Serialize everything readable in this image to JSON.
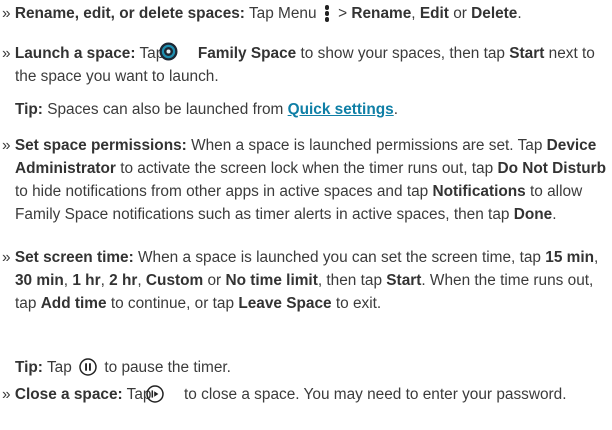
{
  "bullet": "»",
  "items": {
    "rename": {
      "title": "Rename, edit, or delete spaces:",
      "t1": "Tap Menu",
      "t2": ">",
      "b1": "Rename",
      "t3": ",",
      "b2": "Edit",
      "t4": "or",
      "b3": "Delete",
      "t5": "."
    },
    "launch": {
      "title": "Launch a space:",
      "t1": "Tap",
      "b1": "Family Space",
      "t2": "to show your spaces, then tap",
      "b2": "Start",
      "t3": "next to the space you want to launch."
    },
    "tip1": {
      "label": "Tip:",
      "t1": "Spaces can also be launched from",
      "link": "Quick settings",
      "t2": "."
    },
    "permissions": {
      "title": "Set space permissions:",
      "t1": "When a space is launched permissions are set. Tap",
      "b1": "Device Administrator",
      "t2": "to activate the screen lock when the timer runs out, tap",
      "b2": "Do Not Disturb",
      "t3": "to hide notifications from other apps in active spaces and tap",
      "b3": "Notifications",
      "t4": "to allow Family Space notifications such as timer alerts in active spaces, then tap",
      "b4": "Done",
      "t5": "."
    },
    "screentime": {
      "title": "Set screen time:",
      "t1": "When a space is launched you can set the screen time, tap",
      "b1": "15 min",
      "c1": ",",
      "b2": "30 min",
      "c2": ",",
      "b3": "1 hr",
      "c3": ",",
      "b4": "2 hr",
      "c4": ",",
      "b5": "Custom",
      "t2": "or",
      "b6": "No time limit",
      "t3": ", then tap",
      "b7": "Start",
      "t4": ". When the time runs out, tap",
      "b8": "Add time",
      "t5": "to continue, or tap",
      "b9": "Leave Space",
      "t6": "to exit."
    },
    "tip2": {
      "label": "Tip:",
      "t1": "Tap",
      "t2": "to pause the timer."
    },
    "close": {
      "title": "Close a space:",
      "t1": "Tap",
      "t2": "to close a space. You may need to enter your password."
    }
  },
  "icons": {
    "menu": "menu-kebab-icon",
    "family_space": "family-space-app-icon",
    "pause": "pause-icon",
    "exit": "exit-space-icon"
  },
  "colors": {
    "text": "#3b3b3b",
    "bold": "#333333",
    "link": "#0f7fa6",
    "app_icon_ring": "#1f8fb0",
    "app_icon_fill": "#1d2733"
  }
}
